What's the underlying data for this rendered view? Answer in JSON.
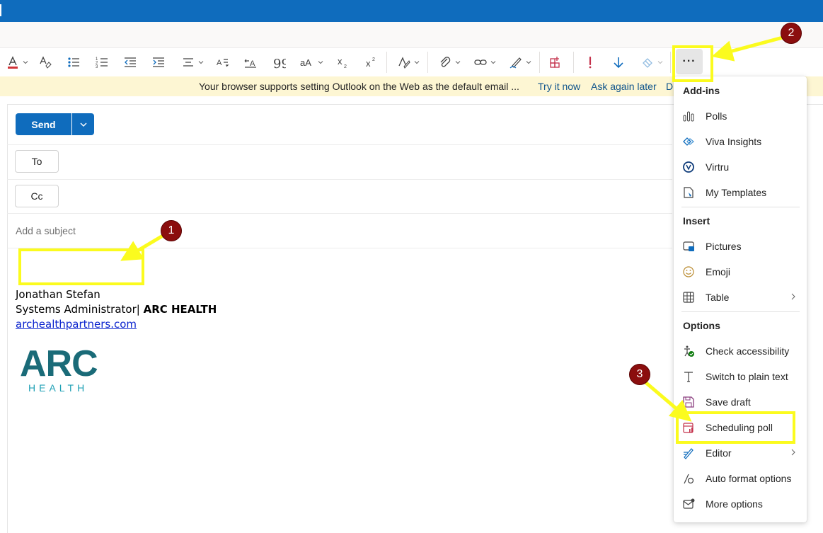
{
  "ribbon": {
    "more_label": "···"
  },
  "infobar": {
    "message": "Your browser supports setting Outlook on the Web as the default email ...",
    "try_it": "Try it now",
    "ask_later": "Ask again later",
    "truncated": "D"
  },
  "compose": {
    "send_label": "Send",
    "to_label": "To",
    "cc_label": "Cc",
    "subject_placeholder": "Add a subject"
  },
  "signature": {
    "name": "Jonathan Stefan",
    "title": "Systems Administrator|",
    "company": "ARC HEALTH",
    "link": "archealthpartners.com",
    "logo_main": "ARC",
    "logo_sub": "HEALTH"
  },
  "menu": {
    "addins_header": "Add-ins",
    "insert_header": "Insert",
    "options_header": "Options",
    "addins": [
      {
        "label": "Polls",
        "icon": "polls-icon"
      },
      {
        "label": "Viva Insights",
        "icon": "viva-insights-icon"
      },
      {
        "label": "Virtru",
        "icon": "virtru-icon"
      },
      {
        "label": "My Templates",
        "icon": "templates-icon"
      }
    ],
    "insert": [
      {
        "label": "Pictures",
        "icon": "pictures-icon"
      },
      {
        "label": "Emoji",
        "icon": "emoji-icon"
      },
      {
        "label": "Table",
        "icon": "table-icon"
      }
    ],
    "options": [
      {
        "label": "Check accessibility",
        "icon": "accessibility-icon"
      },
      {
        "label": "Switch to plain text",
        "icon": "plain-text-icon"
      },
      {
        "label": "Save draft",
        "icon": "save-icon"
      },
      {
        "label": "Scheduling poll",
        "icon": "scheduling-poll-icon"
      },
      {
        "label": "Editor",
        "icon": "editor-icon"
      },
      {
        "label": "Auto format options",
        "icon": "auto-format-icon"
      },
      {
        "label": "More options",
        "icon": "more-options-icon"
      }
    ]
  },
  "annotations": {
    "badge_1": "1",
    "badge_2": "2",
    "badge_3": "3"
  },
  "colors": {
    "brand_blue": "#0f6cbd",
    "highlight_yellow": "#fbfb1e",
    "badge_red": "#8b0e0e",
    "info_bar": "#fdf6d3"
  }
}
